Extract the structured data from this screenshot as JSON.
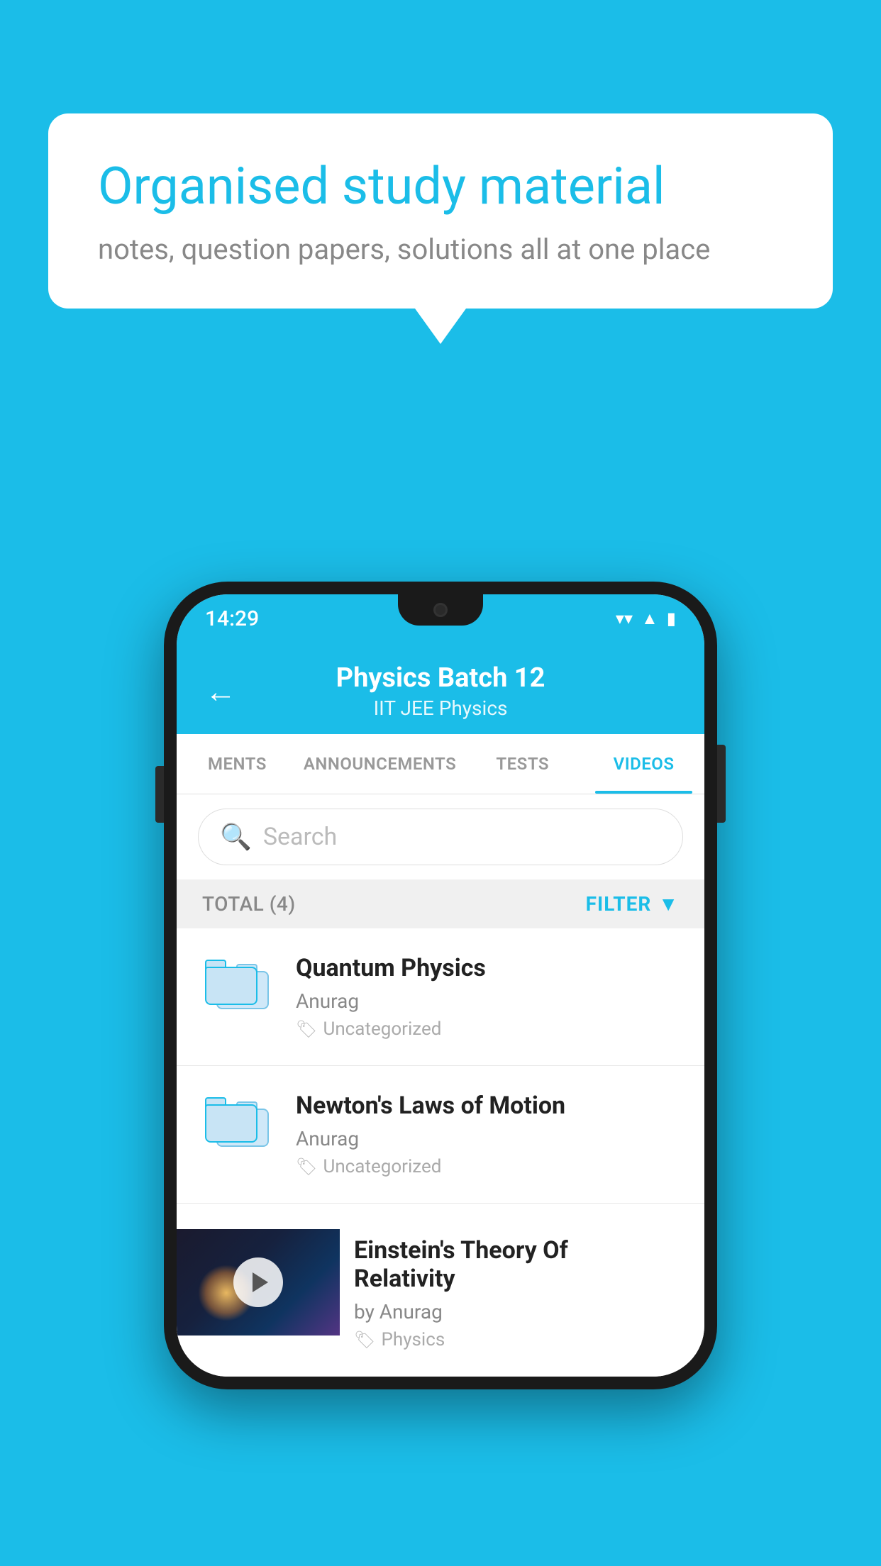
{
  "background_color": "#1bbde8",
  "speech_bubble": {
    "title": "Organised study material",
    "subtitle": "notes, question papers, solutions all at one place"
  },
  "phone": {
    "status_bar": {
      "time": "14:29",
      "icons": [
        "wifi",
        "signal",
        "battery"
      ]
    },
    "header": {
      "back_label": "←",
      "title": "Physics Batch 12",
      "subtitle": "IIT JEE   Physics"
    },
    "tabs": [
      {
        "label": "MENTS",
        "active": false
      },
      {
        "label": "ANNOUNCEMENTS",
        "active": false
      },
      {
        "label": "TESTS",
        "active": false
      },
      {
        "label": "VIDEOS",
        "active": true
      }
    ],
    "search": {
      "placeholder": "Search"
    },
    "filter_bar": {
      "total": "TOTAL (4)",
      "filter_label": "FILTER"
    },
    "video_list": [
      {
        "title": "Quantum Physics",
        "author": "Anurag",
        "tag": "Uncategorized",
        "has_thumb": false
      },
      {
        "title": "Newton's Laws of Motion",
        "author": "Anurag",
        "tag": "Uncategorized",
        "has_thumb": false
      },
      {
        "title": "Einstein's Theory Of Relativity",
        "author": "by Anurag",
        "tag": "Physics",
        "has_thumb": true
      }
    ]
  }
}
